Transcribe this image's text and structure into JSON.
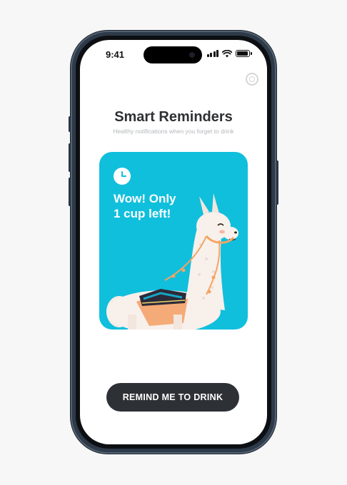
{
  "status_bar": {
    "time": "9:41"
  },
  "header": {
    "title": "Smart Reminders",
    "subtitle": "Healthy notifications when you forget to drink"
  },
  "card": {
    "message": "Wow! Only\n1 cup left!",
    "background": "#10bfdc"
  },
  "cta": {
    "label": "REMIND ME TO DRINK"
  },
  "colors": {
    "accent": "#10bfdc",
    "button": "#2d3035",
    "title": "#2f3033"
  },
  "icons": [
    "settings-icon",
    "clock-icon",
    "signal-icon",
    "wifi-icon",
    "battery-icon"
  ]
}
